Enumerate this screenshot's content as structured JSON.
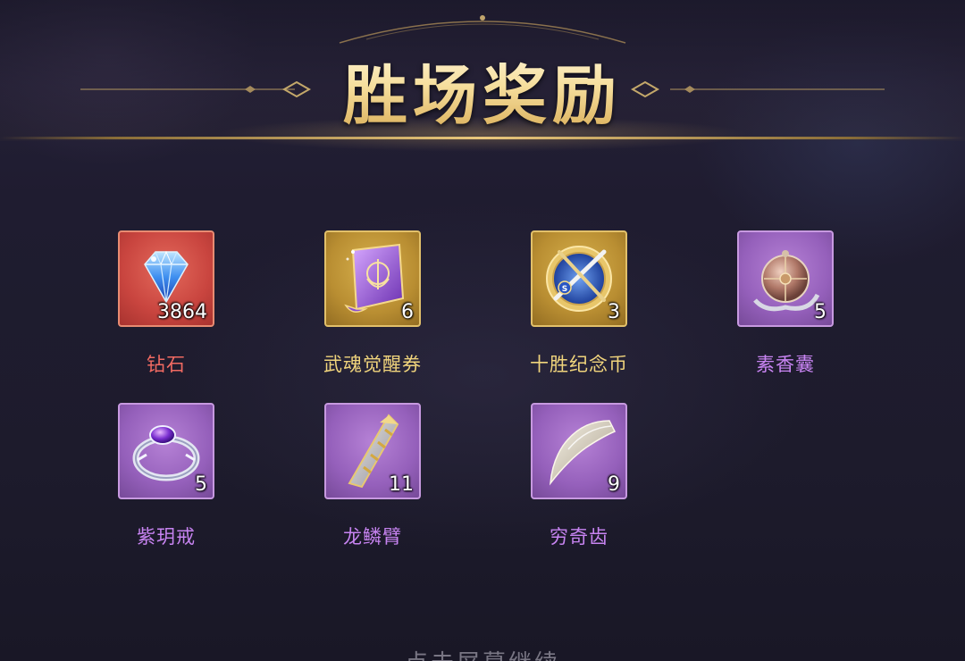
{
  "header": {
    "title": "胜场奖励",
    "accent_color": "#e9c77c"
  },
  "rewards": [
    {
      "name": "钻石",
      "quantity": "3864",
      "rarity": "red",
      "icon": "blue-diamond-icon"
    },
    {
      "name": "武魂觉醒券",
      "quantity": "6",
      "rarity": "gold",
      "icon": "purple-scroll-icon"
    },
    {
      "name": "十胜纪念币",
      "quantity": "3",
      "rarity": "gold",
      "icon": "sword-coin-icon"
    },
    {
      "name": "素香囊",
      "quantity": "5",
      "rarity": "purple",
      "icon": "sachet-orb-icon"
    },
    {
      "name": "紫玥戒",
      "quantity": "5",
      "rarity": "purple",
      "icon": "amethyst-ring-icon"
    },
    {
      "name": "龙鳞臂",
      "quantity": "11",
      "rarity": "purple",
      "icon": "dragon-scale-arm-icon"
    },
    {
      "name": "穷奇齿",
      "quantity": "9",
      "rarity": "purple",
      "icon": "fang-tooth-icon"
    }
  ],
  "footer": {
    "hint": "点击屏幕继续"
  },
  "colors": {
    "red_frame": "#c9453f",
    "gold_frame": "#b98e32",
    "purple_frame": "#9560bb",
    "red_name": "#f06a62",
    "gold_name": "#f0d47c",
    "purple_name": "#c884f2"
  }
}
